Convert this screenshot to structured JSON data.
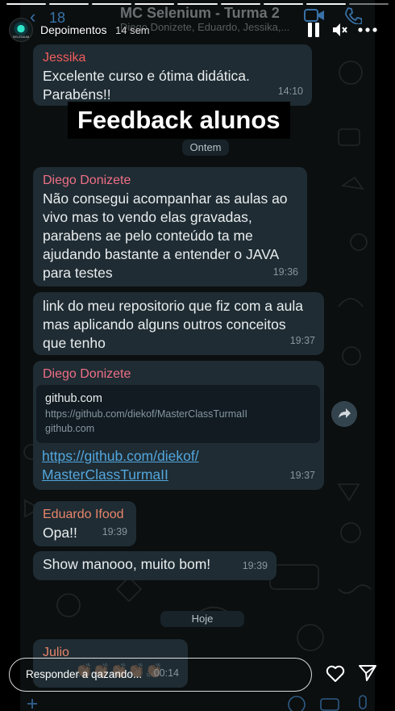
{
  "story": {
    "username": "Depoimentos",
    "time_ago": "14 sem",
    "avatar_label": "SELENIUM",
    "overlay_title": "Feedback alunos",
    "reply_placeholder": "Responder a qazando..."
  },
  "whatsapp": {
    "back_count": "18",
    "chat_title": "MC Selenium - Turma 2",
    "chat_subtitle": "Diego Donizete, Eduardo, Jessika,..."
  },
  "messages": {
    "jessika": {
      "sender": "Jessika",
      "text": "Excelente curso e ótima didática.\nParabéns!!",
      "time": "14:10"
    },
    "date_ontem": "Ontem",
    "diego1": {
      "sender": "Diego Donizete",
      "text": "Não consegui acompanhar as aulas ao\nvivo mas to vendo elas gravadas,\nparabens ae pelo conteúdo ta me\najudando bastante a entender o JAVA\npara testes",
      "time": "19:36"
    },
    "diego2": {
      "text": "link do meu repositorio que fiz com a aula\nmas aplicando alguns outros conceitos\nque tenho",
      "time": "19:37"
    },
    "diego3": {
      "sender": "Diego Donizete",
      "preview_title": "github.com",
      "preview_url": "https://github.com/diekof/MasterClassTurmaII",
      "preview_domain": "github.com",
      "link": "https://github.com/diekof/\nMasterClassTurmaII",
      "time": "19:37"
    },
    "eduardo": {
      "sender": "Eduardo Ifood",
      "text": "Opa!!",
      "time": "19:39"
    },
    "eduardo2": {
      "text": "Show manooo, muito bom!",
      "time": "19:39"
    },
    "date_hoje": "Hoje",
    "julio": {
      "sender": "Julio",
      "emoji": "👏🏽👏🏽👏🏽👏🏽👏🏽",
      "time": "00:14"
    }
  },
  "colors": {
    "chat_bg": "#0b0f10",
    "bubble": "#1f2c33",
    "link": "#53a6dd",
    "timestamp": "#8696a0"
  },
  "icons": [
    "pause-icon",
    "mute-icon",
    "more-icon",
    "forward-icon",
    "heart-icon",
    "send-icon",
    "video-call-icon",
    "phone-icon",
    "back-chevron-icon"
  ]
}
